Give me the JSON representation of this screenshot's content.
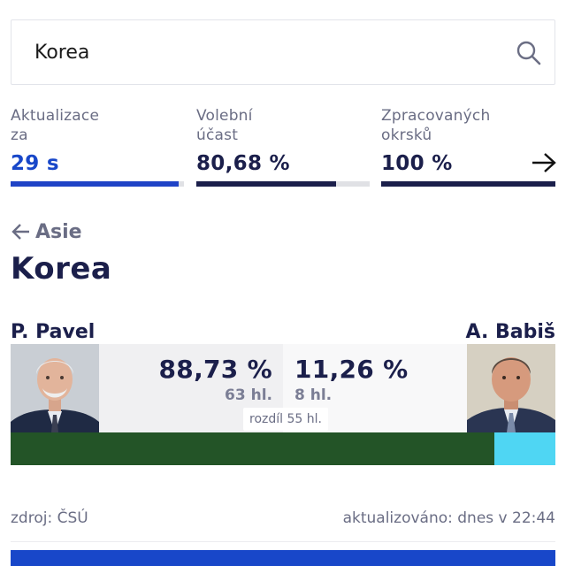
{
  "search": {
    "value": "Korea",
    "placeholder": "",
    "icon": "search-icon"
  },
  "stats": [
    {
      "label_line1": "Aktualizace",
      "label_line2": "za",
      "value": "29 s",
      "progress": 0.97,
      "accent": "#1847c9"
    },
    {
      "label_line1": "Volební",
      "label_line2": "účast",
      "value": "80,68 %",
      "progress": 0.8068,
      "accent": "#1b1f4b"
    },
    {
      "label_line1": "Zpracovaných",
      "label_line2": "okrsků",
      "value": "100 %",
      "progress": 1.0,
      "accent": "#1b1f4b"
    }
  ],
  "nav": {
    "back_label": "Asie",
    "title": "Korea"
  },
  "result": {
    "left": {
      "name": "P. Pavel",
      "pct": "88,73 %",
      "votes": "63 hl.",
      "share": 0.8873,
      "color": "#235427"
    },
    "right": {
      "name": "A. Babiš",
      "pct": "11,26 %",
      "votes": "8 hl.",
      "share": 0.1126,
      "color": "#4fd6f3"
    },
    "diff": "rozdíl 55 hl."
  },
  "footer": {
    "source": "zdroj: ČSÚ",
    "updated": "aktualizováno: dnes v 22:44"
  },
  "colors": {
    "navy": "#1b1f4b",
    "blue": "#1847c9",
    "muted": "#6a6d84"
  }
}
